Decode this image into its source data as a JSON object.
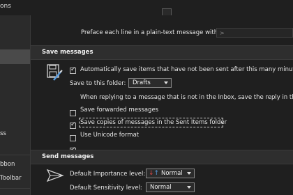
{
  "window": {
    "title_fragment": "ons"
  },
  "sidebar": {
    "items": [
      {
        "label": "ss"
      },
      {
        "label": "bbon"
      },
      {
        "label": "Toolbar"
      },
      {
        "label": ""
      }
    ]
  },
  "main": {
    "preface": {
      "label": "Preface each line in a plain-text message with:",
      "value": ">"
    },
    "save_messages": {
      "header": "Save messages",
      "icon": "save-disk-icon",
      "autosave": {
        "label": "Automatically save items that have not been sent after this many minutes:",
        "checked": true
      },
      "save_to_folder": {
        "label": "Save to this folder:",
        "value": "Drafts"
      },
      "replying": {
        "label": "When replying to a message that is not in the Inbox, save the reply in the",
        "checked": false
      },
      "save_forwarded": {
        "label": "Save forwarded messages",
        "checked": true
      },
      "save_copies": {
        "label": "Save copies of messages in the Sent Items folder",
        "checked": false
      },
      "unicode": {
        "label": "Use Unicode format",
        "checked": true
      }
    },
    "send_messages": {
      "header": "Send messages",
      "icon": "send-arrow-icon",
      "importance": {
        "label": "Default Importance level:",
        "value": "Normal"
      },
      "sensitivity": {
        "label": "Default Sensitivity level:",
        "value": "Normal"
      }
    }
  },
  "colors": {
    "background": "#1f1f1f",
    "section_header": "#2e2e2e",
    "sidebar": "#2b2b2b",
    "importance_up": "#e04848",
    "importance_down": "#5aa0e6",
    "icon_accent": "#5aa0e6"
  }
}
